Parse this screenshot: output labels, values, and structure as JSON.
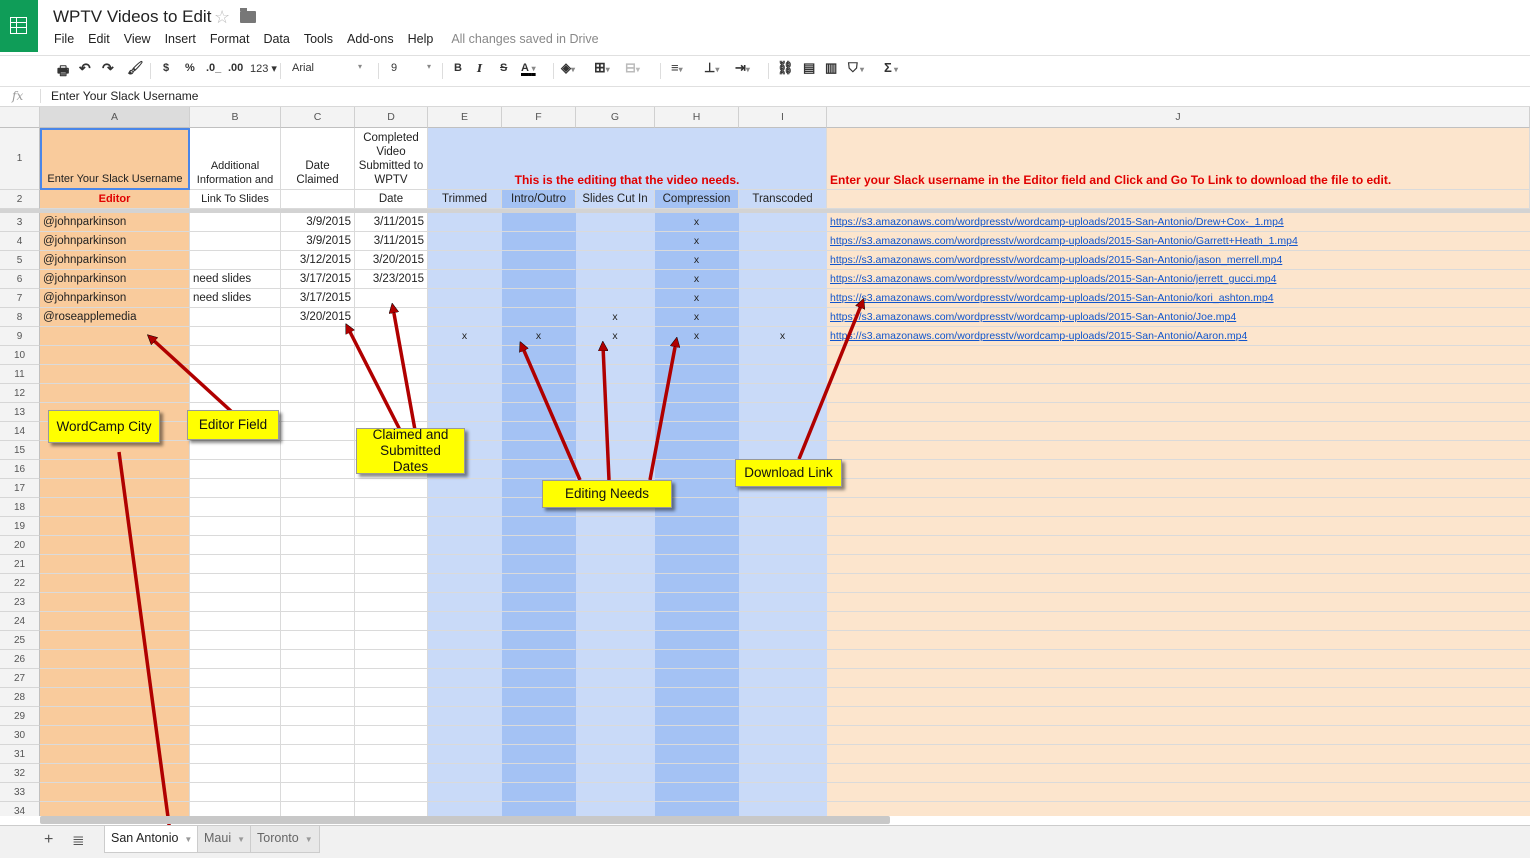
{
  "app": {
    "title": "WPTV Videos to Edit",
    "menu": [
      "File",
      "Edit",
      "View",
      "Insert",
      "Format",
      "Data",
      "Tools",
      "Add-ons",
      "Help"
    ],
    "saved_status": "All changes saved in Drive"
  },
  "toolbar": {
    "currency": "$",
    "percent": "%",
    "dec_less": ".0_",
    "dec_more": ".00",
    "more_formats": "123",
    "font": "Arial",
    "font_size": "9",
    "bold": "B",
    "italic": "I",
    "strike": "S",
    "text_color": "A",
    "sum": "Σ"
  },
  "formula_bar": {
    "fx": "fx",
    "content": "Enter Your Slack Username"
  },
  "columns": [
    "A",
    "B",
    "C",
    "D",
    "E",
    "F",
    "G",
    "H",
    "I",
    "J"
  ],
  "header_row1": {
    "A": "Enter Your Slack Username",
    "B": "Additional Information and",
    "C": "Date Claimed",
    "D": "Completed Video Submitted to WPTV",
    "EI": "This is the editing that the video needs.",
    "J": "Enter your Slack username in the Editor field and Click and Go To Link to download the file to edit."
  },
  "header_row2": [
    "Editor",
    "Link To Slides",
    "",
    "Date",
    "Trimmed",
    "Intro/Outro",
    "Slides Cut In",
    "Compression",
    "Transcoded",
    ""
  ],
  "rows": [
    {
      "n": "3",
      "a": "@johnparkinson",
      "b": "",
      "c": "3/9/2015",
      "d": "3/11/2015",
      "e": "",
      "f": "",
      "g": "",
      "h": "x",
      "i": "",
      "j": "https://s3.amazonaws.com/wordpresstv/wordcamp-uploads/2015-San-Antonio/Drew+Cox-_1.mp4"
    },
    {
      "n": "4",
      "a": "@johnparkinson",
      "b": "",
      "c": "3/9/2015",
      "d": "3/11/2015",
      "e": "",
      "f": "",
      "g": "",
      "h": "x",
      "i": "",
      "j": "https://s3.amazonaws.com/wordpresstv/wordcamp-uploads/2015-San-Antonio/Garrett+Heath_1.mp4"
    },
    {
      "n": "5",
      "a": "@johnparkinson",
      "b": "",
      "c": "3/12/2015",
      "d": "3/20/2015",
      "e": "",
      "f": "",
      "g": "",
      "h": "x",
      "i": "",
      "j": "https://s3.amazonaws.com/wordpresstv/wordcamp-uploads/2015-San-Antonio/jason_merrell.mp4"
    },
    {
      "n": "6",
      "a": "@johnparkinson",
      "b": "need slides",
      "c": "3/17/2015",
      "d": "3/23/2015",
      "e": "",
      "f": "",
      "g": "",
      "h": "x",
      "i": "",
      "j": "https://s3.amazonaws.com/wordpresstv/wordcamp-uploads/2015-San-Antonio/jerrett_gucci.mp4"
    },
    {
      "n": "7",
      "a": "@johnparkinson",
      "b": "need slides",
      "c": "3/17/2015",
      "d": "",
      "e": "",
      "f": "",
      "g": "",
      "h": "x",
      "i": "",
      "j": "https://s3.amazonaws.com/wordpresstv/wordcamp-uploads/2015-San-Antonio/kori_ashton.mp4"
    },
    {
      "n": "8",
      "a": "@roseapplemedia",
      "b": "",
      "c": "3/20/2015",
      "d": "",
      "e": "",
      "f": "",
      "g": "x",
      "h": "x",
      "i": "",
      "j": "https://s3.amazonaws.com/wordpresstv/wordcamp-uploads/2015-San-Antonio/Joe.mp4"
    },
    {
      "n": "9",
      "a": "",
      "b": "",
      "c": "",
      "d": "",
      "e": "x",
      "f": "x",
      "g": "x",
      "h": "x",
      "i": "x",
      "j": "https://s3.amazonaws.com/wordpresstv/wordcamp-uploads/2015-San-Antonio/Aaron.mp4"
    }
  ],
  "empty_rows": [
    "10",
    "11",
    "12",
    "13",
    "14",
    "15",
    "16",
    "17",
    "18",
    "19",
    "20",
    "21",
    "22",
    "23",
    "24",
    "25",
    "26",
    "27",
    "28",
    "29",
    "30",
    "31",
    "32",
    "33",
    "34"
  ],
  "callouts": {
    "wordcamp_city": "WordCamp City",
    "editor_field": "Editor Field",
    "claimed_dates": "Claimed and Submitted Dates",
    "editing_needs": "Editing Needs",
    "download_link": "Download Link"
  },
  "sheets": [
    "San Antonio",
    "Maui",
    "Toronto"
  ],
  "colors": {
    "editor_col": "#f9cb9c",
    "editing_light": "#c9daf8",
    "editing_dark": "#a4c2f4",
    "download_col": "#fce5cd",
    "arrow": "#b00000",
    "callout": "#ffff00"
  }
}
